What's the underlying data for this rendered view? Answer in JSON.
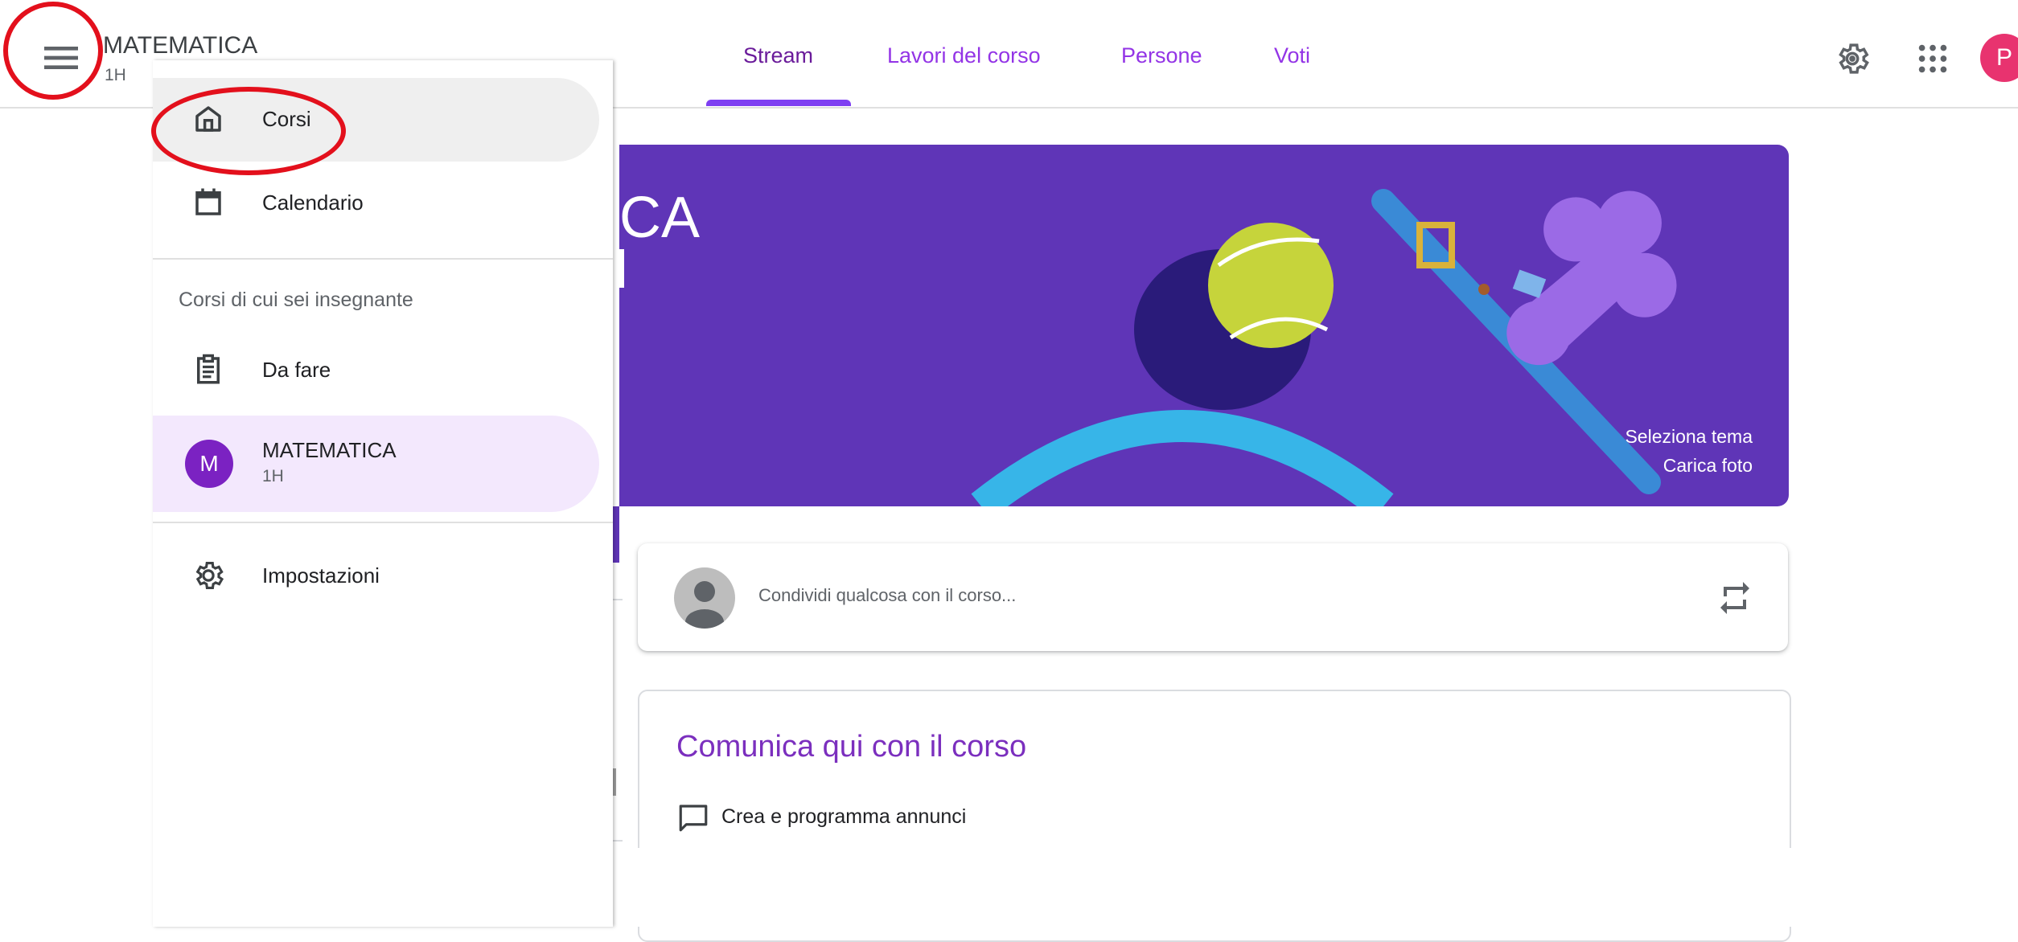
{
  "header": {
    "class_title": "MATEMATICA",
    "class_section": "1H",
    "avatar_letter": "P"
  },
  "tabs": [
    {
      "label": "Stream",
      "active": true
    },
    {
      "label": "Lavori del corso"
    },
    {
      "label": "Persone"
    },
    {
      "label": "Voti"
    }
  ],
  "icons": {
    "menu": "hamburger-menu-icon",
    "settings": "gear-icon",
    "apps": "apps-grid-icon",
    "home": "home-icon",
    "calendar": "calendar-icon",
    "todo": "clipboard-icon",
    "drawer_settings": "gear-icon",
    "repost": "repost-icon",
    "comment": "comment-icon"
  },
  "drawer": {
    "items": [
      {
        "label": "Corsi"
      },
      {
        "label": "Calendario"
      }
    ],
    "section_title": "Corsi di cui sei insegnante",
    "todo_label": "Da fare",
    "class": {
      "letter": "M",
      "title": "MATEMATICA",
      "section": "1H"
    },
    "settings_label": "Impostazioni"
  },
  "banner": {
    "title_visible": "CA",
    "select_theme": "Seleziona tema",
    "upload_photo": "Carica foto"
  },
  "share": {
    "placeholder": "Condividi qualcosa con il corso..."
  },
  "info": {
    "title": "Comunica qui con il corso",
    "row_text": "Crea e programma annunci"
  },
  "colors": {
    "accent": "#7e3ff2",
    "banner": "#5f35b7",
    "avatar": "#e8336f",
    "drawer_selected": "#f3e8fd",
    "annotation": "#e3101c"
  }
}
